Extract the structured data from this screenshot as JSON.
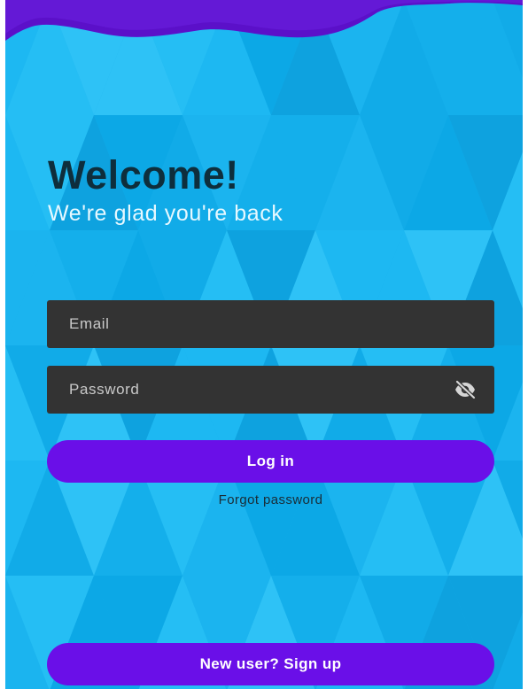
{
  "header": {
    "title": "Welcome!",
    "subtitle": "We're glad you're back"
  },
  "form": {
    "email": {
      "value": "",
      "placeholder": "Email"
    },
    "password": {
      "value": "",
      "placeholder": "Password"
    },
    "login_label": "Log in",
    "forgot_label": "Forgot password"
  },
  "footer": {
    "signup_label": "New user? Sign up"
  },
  "icons": {
    "password_toggle": "eye-off-icon"
  },
  "colors": {
    "background": "#1ab3ee",
    "wave": "#5b10c9",
    "button": "#6a0fe8",
    "field": "#333333",
    "title": "#0e2e3c",
    "subtitle": "#e6f8ff"
  }
}
